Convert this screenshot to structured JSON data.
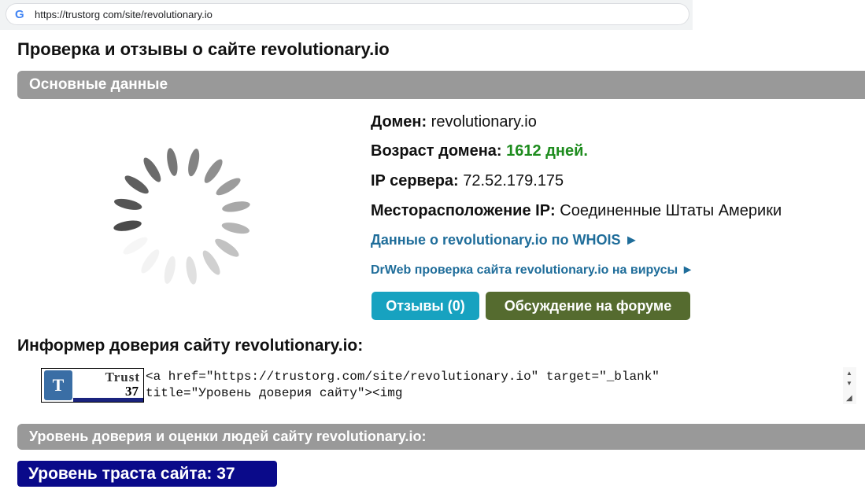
{
  "browser": {
    "url": "https://trustorg com/site/revolutionary.io",
    "favicon_letter": "G"
  },
  "page_title": "Проверка и отзывы о сайте revolutionary.io",
  "sections": {
    "main": "Основные данные",
    "trust": "Уровень доверия и оценки людей сайту revolutionary.io:"
  },
  "info": {
    "domain_label": "Домен:",
    "domain_value": "revolutionary.io",
    "age_label": "Возраст домена:",
    "age_value": "1612 дней.",
    "ip_label": "IP сервера:",
    "ip_value": "72.52.179.175",
    "location_label": "Месторасположение IP:",
    "location_value": "Соединенные Штаты Америки"
  },
  "links": {
    "whois": "Данные о revolutionary.io по WHOIS ►",
    "drweb": "DrWeb проверка сайта revolutionary.io на вирусы ►"
  },
  "buttons": {
    "reviews": "Отзывы (0)",
    "forum": "Обсуждение на форуме"
  },
  "informer": {
    "title": "Информер доверия сайту revolutionary.io:",
    "badge_word": "Trust",
    "badge_value": "37",
    "code_line1": "<a href=\"https://trustorg.com/site/revolutionary.io\" target=\"_blank\"",
    "code_line2": "title=\"Уровень доверия сайту\"><img"
  },
  "trust_level": "Уровень траста сайта: 37",
  "colors": {
    "section_bar": "#999999",
    "link": "#1f6d9a",
    "age_green": "#1e8c1e",
    "reviews_button": "#17a2c0",
    "forum_button": "#556b2f",
    "trust_level_bg": "#0a0a8a"
  },
  "icons": {
    "spinner": "loading-spinner-icon",
    "scroll_up": "scroll-up-arrow-icon",
    "scroll_down": "scroll-down-arrow-icon"
  }
}
